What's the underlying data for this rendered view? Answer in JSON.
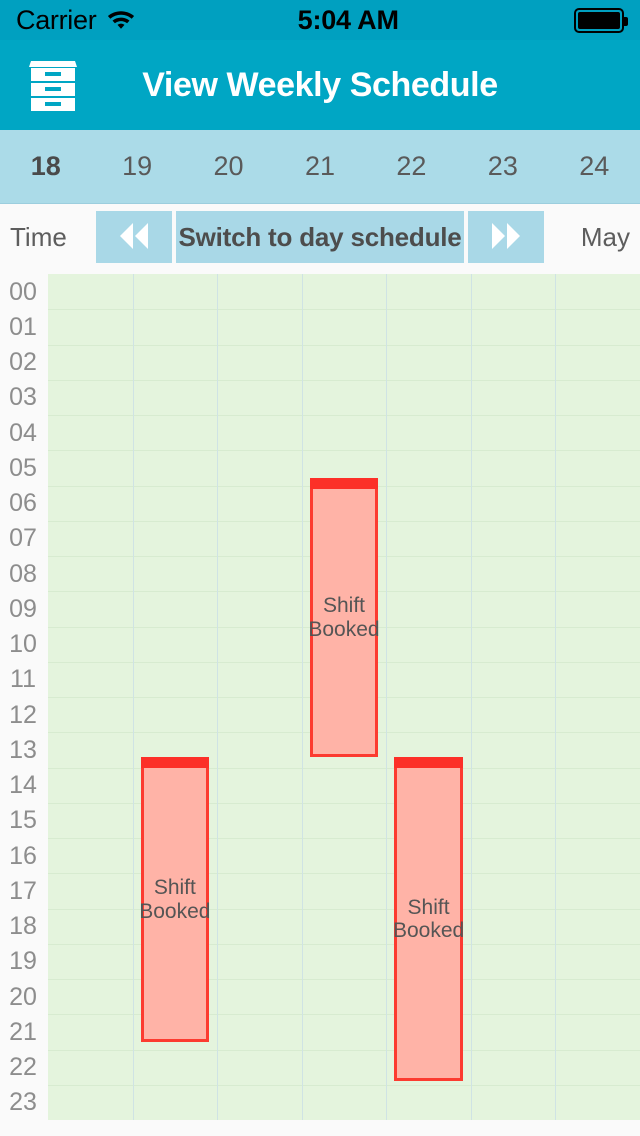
{
  "status_bar": {
    "carrier": "Carrier",
    "time": "5:04 AM",
    "wifi_icon": "wifi-icon",
    "battery_icon": "battery-full-icon"
  },
  "nav_bar": {
    "title": "View Weekly Schedule",
    "left_icon": "filing-cabinet-icon",
    "background_color": "#00a6c4"
  },
  "days_strip": {
    "background_color": "#abdbe8",
    "days": [
      {
        "label": "18",
        "today": true
      },
      {
        "label": "19",
        "today": false
      },
      {
        "label": "20",
        "today": false
      },
      {
        "label": "21",
        "today": false
      },
      {
        "label": "22",
        "today": false
      },
      {
        "label": "23",
        "today": false
      },
      {
        "label": "24",
        "today": false
      }
    ]
  },
  "toolbar": {
    "time_label": "Time",
    "prev_button_icon": "double-chevron-left-icon",
    "switch_button_label": "Switch to day schedule",
    "next_button_icon": "double-chevron-right-icon",
    "month_label": "May",
    "button_color": "#a9d8e7"
  },
  "calendar": {
    "grid_background": "#e4f4dd",
    "hours": [
      "00",
      "01",
      "02",
      "03",
      "04",
      "05",
      "06",
      "07",
      "08",
      "09",
      "10",
      "11",
      "12",
      "13",
      "14",
      "15",
      "16",
      "17",
      "18",
      "19",
      "20",
      "21",
      "22",
      "23"
    ],
    "columns": [
      "18",
      "19",
      "20",
      "21",
      "22",
      "23",
      "24"
    ],
    "shift_fill_color": "#ffb3a7",
    "shift_border_color": "#fc3b30",
    "shifts": [
      {
        "label": "Shift\nBooked",
        "day_index": 1,
        "start_hour": 13.7,
        "end_hour": 21.8
      },
      {
        "label": "Shift\nBooked",
        "day_index": 3,
        "start_hour": 5.8,
        "end_hour": 13.7
      },
      {
        "label": "Shift\nBooked",
        "day_index": 4,
        "start_hour": 13.7,
        "end_hour": 22.9
      }
    ]
  }
}
